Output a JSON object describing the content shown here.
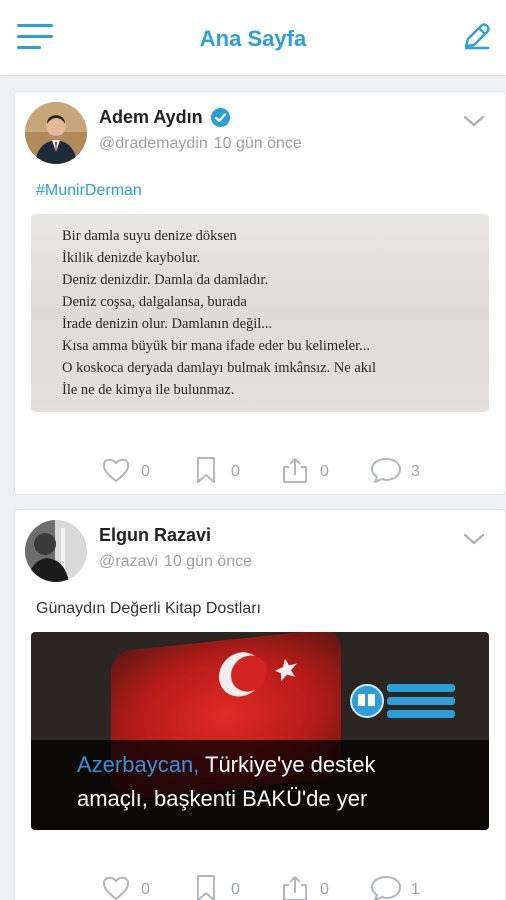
{
  "header": {
    "title": "Ana Sayfa",
    "menu_icon": "hamburger-menu-icon",
    "edit_icon": "pencil-edit-icon",
    "accent_color": "#2a9fd8"
  },
  "posts": [
    {
      "author": "Adem Aydın",
      "verified": true,
      "handle": "@drademaydin",
      "time": "10 gün önce",
      "text": "#MunirDerman",
      "image_text": [
        "Bir damla suyu denize döksen",
        "İkilik denizde kaybolur.",
        "Deniz denizdir. Damla da damladır.",
        "Deniz coşsa, dalgalansa, burada",
        "İrade denizin olur. Damlanın değil...",
        "Kısa amma büyük bir mana ifade eder bu kelimeler...",
        "O koskoca deryada damlayı bulmak imkânsız. Ne akıl",
        "İle ne de kimya ile bulunmaz."
      ],
      "actions": {
        "likes": "0",
        "saves": "0",
        "shares": "0",
        "comments": "3"
      }
    },
    {
      "author": "Elgun Razavi",
      "verified": false,
      "handle": "@razavi",
      "time": "10 gün önce",
      "text": "Günaydın Değerli Kitap Dostları",
      "image_caption": {
        "line1_highlight": "Azerbaycan,",
        "line1_rest": " Türkiye'ye destek",
        "line2": "amaçlı, başkenti BAKÜ'de yer"
      },
      "actions": {
        "likes": "0",
        "saves": "0",
        "shares": "0",
        "comments": "1"
      }
    }
  ]
}
